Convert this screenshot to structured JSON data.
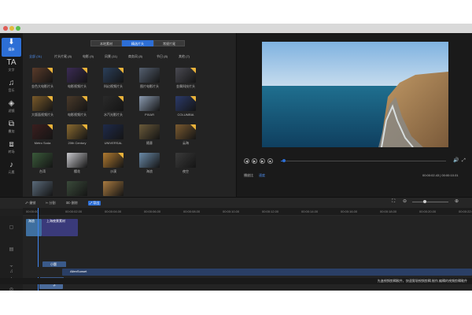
{
  "colors": {
    "accent": "#2d6fd6",
    "frame": "#202020",
    "sidebar": "#181818",
    "title_bar": "#d9d9d9"
  },
  "sidebar": {
    "items": [
      {
        "icon": "download-icon",
        "glyph": "⬇",
        "label": "媒体",
        "active": true
      },
      {
        "icon": "text-icon",
        "glyph": "TA",
        "label": "文字",
        "active": false
      },
      {
        "icon": "music-icon",
        "glyph": "♫",
        "label": "音乐",
        "active": false
      },
      {
        "icon": "filter-icon",
        "glyph": "◈",
        "label": "滤镜",
        "active": false
      },
      {
        "icon": "overlay-icon",
        "glyph": "⧉",
        "label": "叠加",
        "active": false
      },
      {
        "icon": "transition-icon",
        "glyph": "⧈",
        "label": "转场",
        "active": false
      },
      {
        "icon": "element-icon",
        "glyph": "♪",
        "label": "元素",
        "active": false
      }
    ]
  },
  "library": {
    "segments": [
      {
        "label": "本地素材",
        "active": false
      },
      {
        "label": "精选片头",
        "active": true
      },
      {
        "label": "常规片尾",
        "active": false
      }
    ],
    "categories": [
      {
        "label": "全部 (31)",
        "active": true
      },
      {
        "label": "片头片尾 (8)",
        "active": false
      },
      {
        "label": "电影 (9)",
        "active": false
      },
      {
        "label": "风景 (11)",
        "active": false
      },
      {
        "label": "商务风 (8)",
        "active": false
      },
      {
        "label": "节日 (8)",
        "active": false
      },
      {
        "label": "其他 (7)",
        "active": false
      }
    ],
    "tiles": [
      {
        "label": "金色大电影片头",
        "color": "#5a3b2a",
        "badge": true
      },
      {
        "label": "电影视频片头",
        "color": "#3b2b55",
        "badge": true
      },
      {
        "label": "科幻视频片头",
        "color": "#2b3f5a",
        "badge": true
      },
      {
        "label": "图片电影片头",
        "color": "#556070",
        "badge": false
      },
      {
        "label": "金属科技片头",
        "color": "#4a4a52",
        "badge": true
      },
      {
        "label": "大版面视频片头",
        "color": "#7a5a2a",
        "badge": true
      },
      {
        "label": "电影视频片头",
        "color": "#4a3a2a",
        "badge": true
      },
      {
        "label": "水汽光影片头",
        "color": "#2a2a2a",
        "badge": true
      },
      {
        "label": "PIXAR",
        "color": "#8a9ab0",
        "badge": false
      },
      {
        "label": "COLUMBIA",
        "color": "#2b3a6a",
        "badge": true
      },
      {
        "label": "Metro Soda",
        "color": "#3a1e1e",
        "badge": true
      },
      {
        "label": "20th Century",
        "color": "#8a6a30",
        "badge": true
      },
      {
        "label": "UNIVERSAL",
        "color": "#1e2a4a",
        "badge": false
      },
      {
        "label": "随意",
        "color": "#6a5a3a",
        "badge": false
      },
      {
        "label": "云海",
        "color": "#7a5a30",
        "badge": true
      },
      {
        "label": "台湾",
        "color": "#3a5a3a",
        "badge": false
      },
      {
        "label": "樱花",
        "color": "#c8c8cc",
        "badge": false
      },
      {
        "label": "沙漠",
        "color": "#b07a30",
        "badge": true
      },
      {
        "label": "海浪",
        "color": "#6a8aa8",
        "badge": false
      },
      {
        "label": "夜空",
        "color": "#3a3a3a",
        "badge": false
      },
      {
        "label": "城市夜景",
        "color": "#5a6a7a",
        "badge": false
      },
      {
        "label": "城市",
        "color": "#3a4a3a",
        "badge": false
      },
      {
        "label": "人生视频",
        "color": "#a87a40",
        "badge": false
      }
    ]
  },
  "preview": {
    "time_left": "00:00:00",
    "label_speed": "播放比",
    "speed_value": "速度",
    "time_right": "00:00:02.43  |  00:00:10.01",
    "progress": 0.02
  },
  "timeline": {
    "toolbar": [
      {
        "label": "⤺ 撤销",
        "active": false
      },
      {
        "label": "✄ 分割",
        "active": false
      },
      {
        "label": "⌦ 删除",
        "active": false
      },
      {
        "label": "⤢ 导出",
        "active": true
      }
    ],
    "ticks": [
      "00:00:00",
      "00:00:02.00",
      "00:00:04.00",
      "00:00:06.00",
      "00:00:08.00",
      "00:00:10.00",
      "00:00:12.00",
      "00:00:14.00",
      "00:00:16.00",
      "00:00:18.00",
      "00:00:20.00",
      "00:00:22.00",
      "00:00:24.00"
    ],
    "video_clip_label": "海浪",
    "video_clip2_label": "上海夜景素材",
    "text_clips": [
      "小题",
      "小题"
    ],
    "overlay_clip": "字",
    "music_clip": "AllenSunset",
    "status_note": "先進視頻剪輯軟件，快速實現視頻剪輯,制作,編輯的視頻剪輯軟件"
  }
}
